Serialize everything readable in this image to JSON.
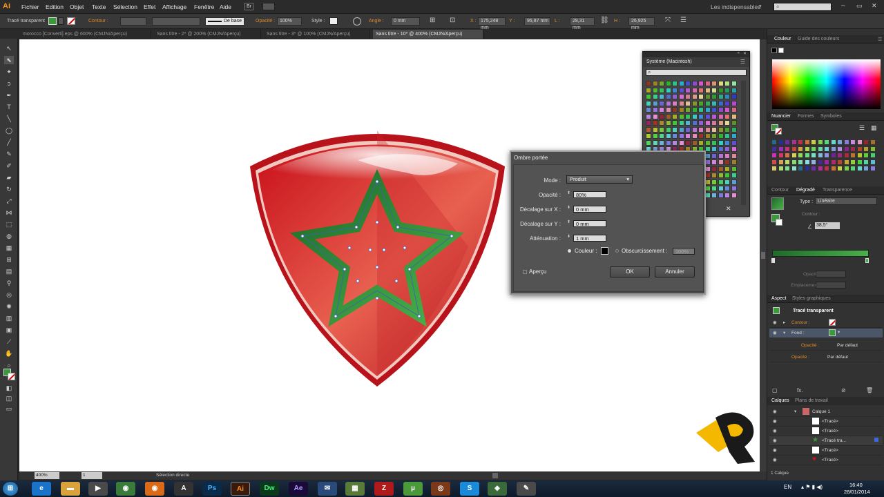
{
  "menubar": {
    "logo": "Ai",
    "items": [
      "Fichier",
      "Edition",
      "Objet",
      "Texte",
      "Sélection",
      "Effet",
      "Affichage",
      "Fenêtre",
      "Aide"
    ],
    "br_badge": "Br",
    "workspace": "Les indispensables",
    "search_placeholder": ""
  },
  "control_bar": {
    "object_label": "Tracé transparent",
    "stroke_label": "Contour :",
    "stroke_style": "De base",
    "opacity_label": "Opacité :",
    "opacity_value": "100%",
    "style_label": "Style :",
    "angle_label": "Angle :",
    "angle_value": "0 mm",
    "x_label": "X :",
    "x_value": "175,248 mm",
    "y_label": "Y :",
    "y_value": "95,87 mm",
    "w_label": "L :",
    "w_value": "28,31 mm",
    "h_label": "H :",
    "h_value": "26,925 mm"
  },
  "tabs": [
    {
      "label": "morocco [Converti].eps @ 600% (CMJN/Aperçu)",
      "active": false
    },
    {
      "label": "Sans titre - 2* @ 200% (CMJN/Aperçu)",
      "active": false
    },
    {
      "label": "Sans titre - 3* @ 100% (CMJN/Aperçu)",
      "active": false
    },
    {
      "label": "Sans titre - 10* @ 400% (CMJN/Aperçu)",
      "active": true
    }
  ],
  "status_bar": {
    "zoom": "400%",
    "artboard": "1",
    "tool": "Sélection directe"
  },
  "swatch_library": {
    "title": "Système (Macintosh)"
  },
  "drop_shadow_dialog": {
    "title": "Ombre portée",
    "mode_label": "Mode :",
    "mode_value": "Produit",
    "opacity_label": "Opacité :",
    "opacity_value": "80%",
    "x_offset_label": "Décalage sur X :",
    "x_offset_value": "0 mm",
    "y_offset_label": "Décalage sur Y :",
    "y_offset_value": "0 mm",
    "blur_label": "Atténuation :",
    "blur_value": "1 mm",
    "color_label": "Couleur :",
    "darkness_label": "Obscurcissement :",
    "darkness_value": "100%",
    "preview_label": "Aperçu",
    "ok_label": "OK",
    "cancel_label": "Annuler"
  },
  "color_panel": {
    "tabs": [
      "Couleur",
      "Guide des couleurs"
    ]
  },
  "swatches_panel": {
    "tabs": [
      "Nuancier",
      "Formes",
      "Symboles"
    ]
  },
  "gradient_panel": {
    "tabs": [
      "Contour",
      "Dégradé",
      "Transparence"
    ],
    "type_label": "Type :",
    "type_value": "Linéaire",
    "stroke_label": "Contour :",
    "angle_value": "38,5°",
    "opacity_label": "Opacité :",
    "location_label": "Emplacement :"
  },
  "appearance_panel": {
    "tabs": [
      "Aspect",
      "Styles graphiques"
    ],
    "object": "Tracé transparent",
    "rows": [
      {
        "label": "Contour :",
        "value": ""
      },
      {
        "label": "Fond :",
        "value": ""
      },
      {
        "label": "Opacité :",
        "value": "Par défaut"
      },
      {
        "label": "Opacité :",
        "value": "Par défaut"
      }
    ]
  },
  "layers_panel": {
    "tabs": [
      "Calques",
      "Plans de travail"
    ],
    "layer": "Calque 1",
    "items": [
      "<Tracé>",
      "<Tracé>",
      "<Tracé tra...",
      "<Tracé>",
      "<Tracé>"
    ],
    "footer": "1 Calque"
  },
  "taskbar": {
    "lang": "EN",
    "time": "16:40",
    "date": "28/01/2014"
  },
  "colors": {
    "accent": "#e28b2c",
    "shield_red": "#c8161d",
    "star_green": "#3a9a3a"
  }
}
